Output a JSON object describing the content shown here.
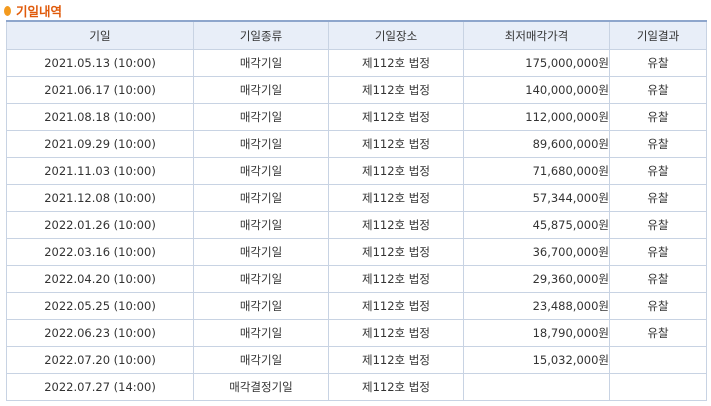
{
  "section": {
    "title": "기일내역"
  },
  "table": {
    "headers": [
      "기일",
      "기일종류",
      "기일장소",
      "최저매각가격",
      "기일결과"
    ],
    "rows": [
      {
        "date": "2021.05.13 (10:00)",
        "type": "매각기일",
        "place": "제112호 법정",
        "price": "175,000,000원",
        "result": "유찰"
      },
      {
        "date": "2021.06.17 (10:00)",
        "type": "매각기일",
        "place": "제112호 법정",
        "price": "140,000,000원",
        "result": "유찰"
      },
      {
        "date": "2021.08.18 (10:00)",
        "type": "매각기일",
        "place": "제112호 법정",
        "price": "112,000,000원",
        "result": "유찰"
      },
      {
        "date": "2021.09.29 (10:00)",
        "type": "매각기일",
        "place": "제112호 법정",
        "price": "89,600,000원",
        "result": "유찰"
      },
      {
        "date": "2021.11.03 (10:00)",
        "type": "매각기일",
        "place": "제112호 법정",
        "price": "71,680,000원",
        "result": "유찰"
      },
      {
        "date": "2021.12.08 (10:00)",
        "type": "매각기일",
        "place": "제112호 법정",
        "price": "57,344,000원",
        "result": "유찰"
      },
      {
        "date": "2022.01.26 (10:00)",
        "type": "매각기일",
        "place": "제112호 법정",
        "price": "45,875,000원",
        "result": "유찰"
      },
      {
        "date": "2022.03.16 (10:00)",
        "type": "매각기일",
        "place": "제112호 법정",
        "price": "36,700,000원",
        "result": "유찰"
      },
      {
        "date": "2022.04.20 (10:00)",
        "type": "매각기일",
        "place": "제112호 법정",
        "price": "29,360,000원",
        "result": "유찰"
      },
      {
        "date": "2022.05.25 (10:00)",
        "type": "매각기일",
        "place": "제112호 법정",
        "price": "23,488,000원",
        "result": "유찰"
      },
      {
        "date": "2022.06.23 (10:00)",
        "type": "매각기일",
        "place": "제112호 법정",
        "price": "18,790,000원",
        "result": "유찰"
      },
      {
        "date": "2022.07.20 (10:00)",
        "type": "매각기일",
        "place": "제112호 법정",
        "price": "15,032,000원",
        "result": ""
      },
      {
        "date": "2022.07.27 (14:00)",
        "type": "매각결정기일",
        "place": "제112호 법정",
        "price": "",
        "result": ""
      }
    ]
  },
  "colors": {
    "title": "#e05a0a",
    "bullet": "#f39a1e",
    "header_bg": "#e8eef8",
    "border": "#c8d3e3"
  }
}
